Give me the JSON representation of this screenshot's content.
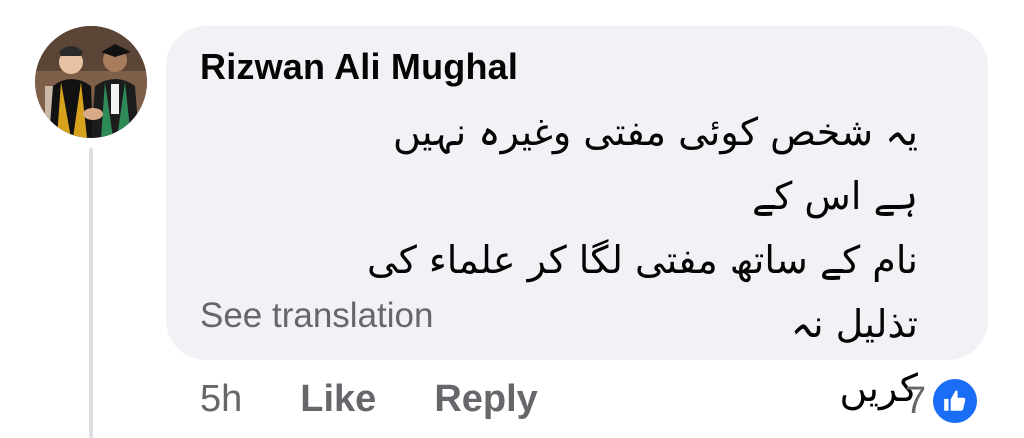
{
  "comment": {
    "author": "Rizwan Ali Mughal",
    "lines": [
      "یہ شخص کوئی مفتی وغیرہ نہیں ہے اس کے",
      "نام کے ساتھ مفتی لگا کر علماء کی تذلیل نہ",
      "کریں"
    ],
    "see_translation": "See translation"
  },
  "actions": {
    "time": "5h",
    "like": "Like",
    "reply": "Reply"
  },
  "reactions": {
    "count": "7",
    "icon": "like-icon",
    "badge_color": "#1a6ef5"
  },
  "colors": {
    "bubble": "#f0f2f5",
    "muted_text": "#65676b",
    "thread_line": "#dcdee2"
  }
}
